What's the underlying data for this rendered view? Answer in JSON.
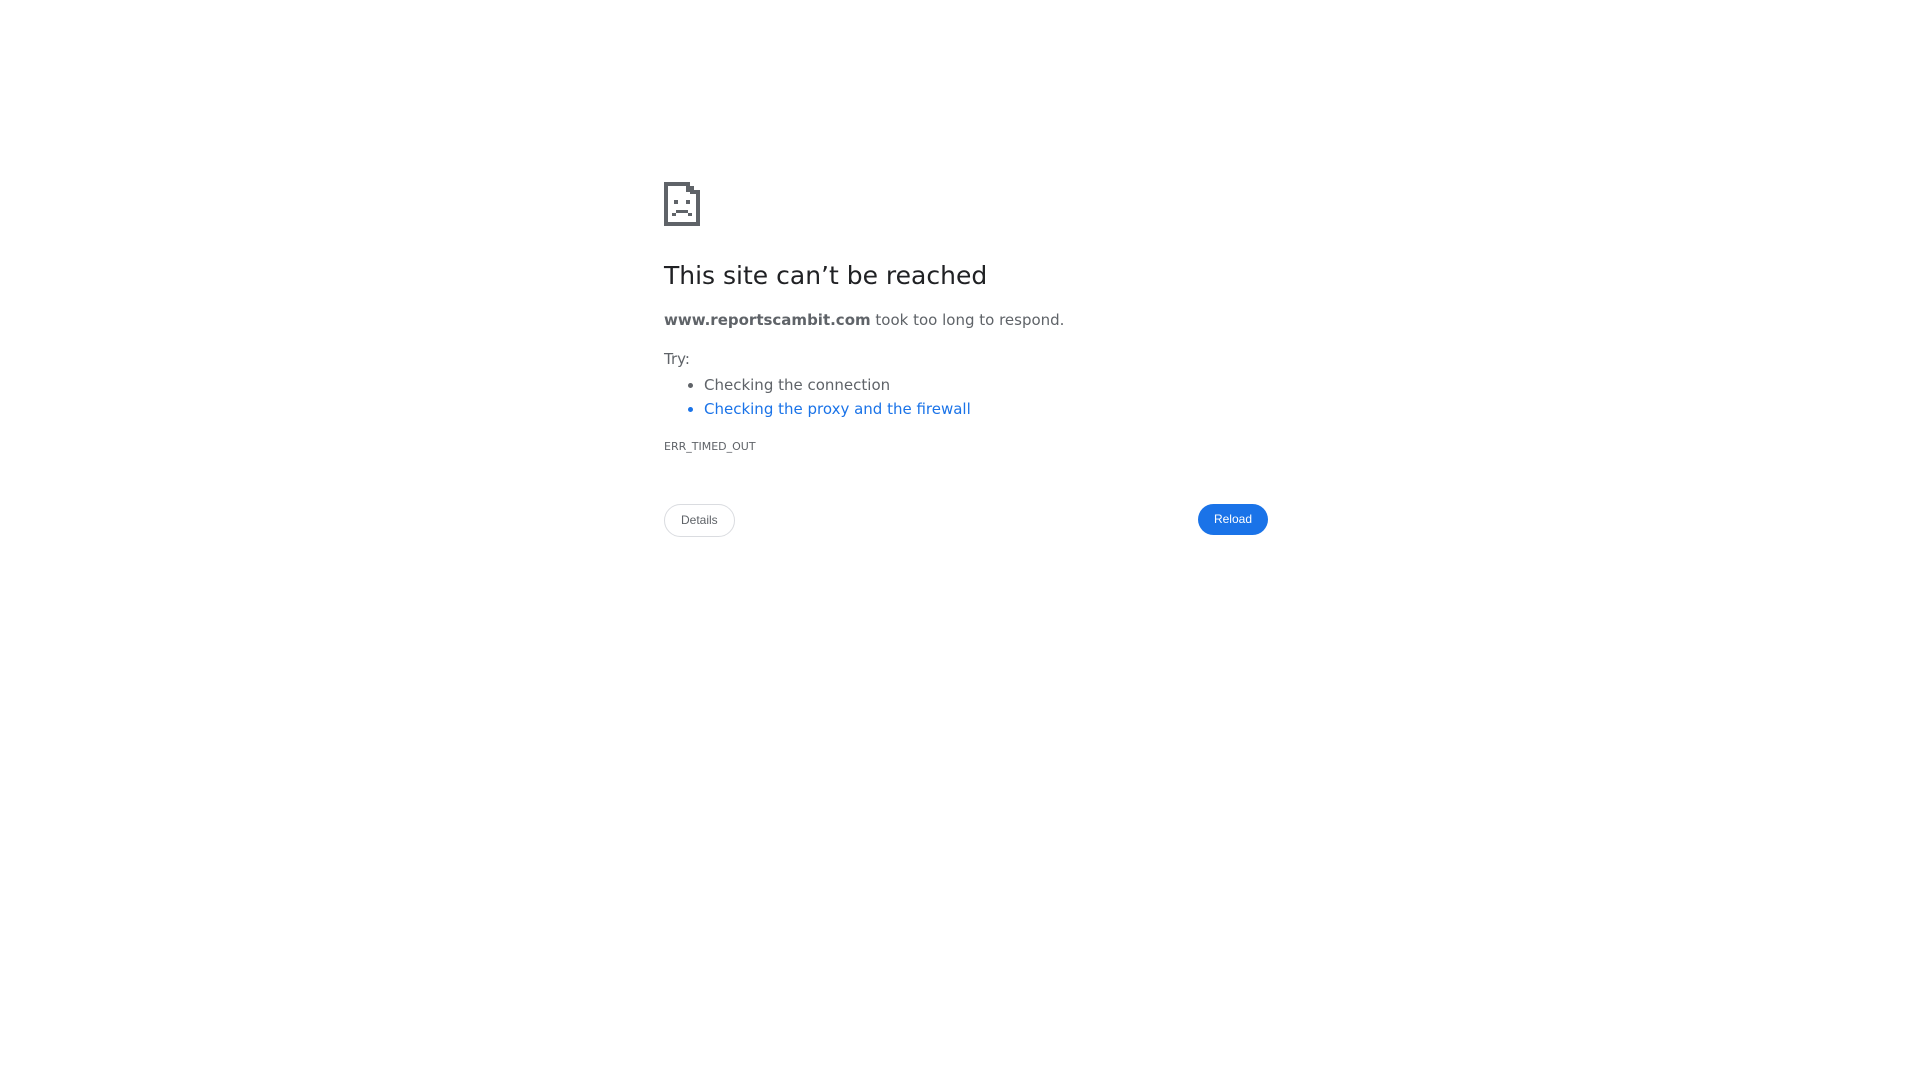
{
  "icon": "sad-page-icon",
  "heading": "This site can’t be reached",
  "message": {
    "domain": "www.reportscambit.com",
    "text": " took too long to respond."
  },
  "try_label": "Try:",
  "suggestions": [
    {
      "label": "Checking the connection",
      "is_link": false
    },
    {
      "label": "Checking the proxy and the firewall",
      "is_link": true
    }
  ],
  "error_code": "ERR_TIMED_OUT",
  "buttons": {
    "details_label": "Details",
    "reload_label": "Reload"
  },
  "colors": {
    "accent": "#1a73e8",
    "text": "#5f6368",
    "heading": "#202124"
  }
}
